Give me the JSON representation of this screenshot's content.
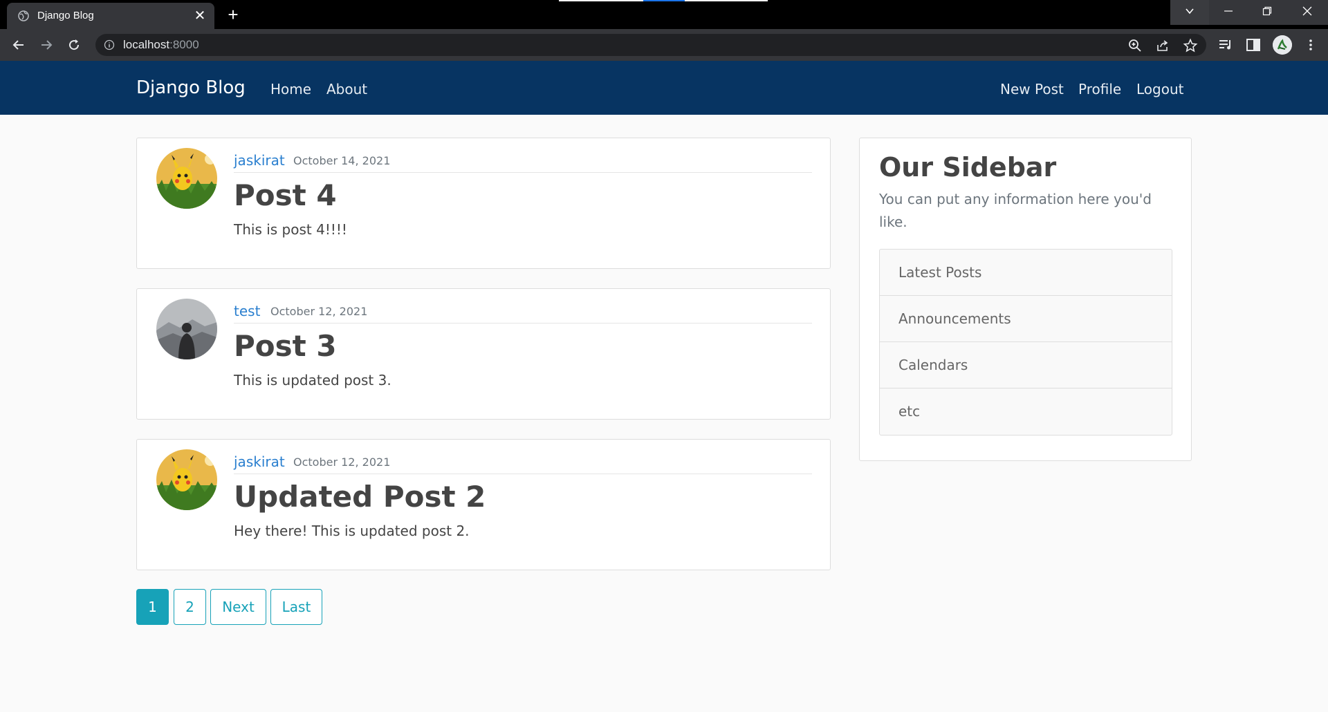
{
  "browser": {
    "tab_title": "Django Blog",
    "url_host": "localhost",
    "url_port": ":8000"
  },
  "navbar": {
    "brand": "Django Blog",
    "left_links": [
      "Home",
      "About"
    ],
    "right_links": [
      "New Post",
      "Profile",
      "Logout"
    ]
  },
  "posts": [
    {
      "author": "jaskirat",
      "date": "October 14, 2021",
      "title": "Post 4",
      "content": "This is post 4!!!!"
    },
    {
      "author": "test",
      "date": "October 12, 2021",
      "title": "Post 3",
      "content": "This is updated post 3."
    },
    {
      "author": "jaskirat",
      "date": "October 12, 2021",
      "title": "Updated Post 2",
      "content": "Hey there! This is updated post 2."
    }
  ],
  "pagination": {
    "pages": [
      "1",
      "2"
    ],
    "next": "Next",
    "last": "Last",
    "current": "1"
  },
  "sidebar": {
    "title": "Our Sidebar",
    "description": "You can put any information here you'd like.",
    "items": [
      "Latest Posts",
      "Announcements",
      "Calendars",
      "etc"
    ]
  },
  "colors": {
    "navbar": "#073462",
    "link": "#2a7fcf",
    "pagination": "#17a2b8"
  }
}
